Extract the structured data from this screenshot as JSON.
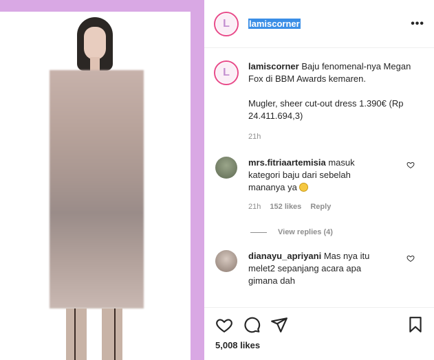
{
  "post": {
    "username": "lamiscorner",
    "avatar_letter": "L",
    "more_label": "•••"
  },
  "caption": {
    "username": "lamiscorner",
    "text": " Baju fenomenal-nya Megan Fox di BBM Awards kemaren.",
    "text2": "Mugler, sheer cut-out dress 1.390€ (Rp 24.411.694,3)",
    "time": "21h"
  },
  "comments": [
    {
      "username": "mrs.fitriaartemisia",
      "text": " masuk kategori baju dari sebelah mananya ya",
      "time": "21h",
      "likes": "152 likes",
      "reply": "Reply",
      "view_replies": "View replies (4)"
    },
    {
      "username": "dianayu_apriyani",
      "text": " Mas nya itu melet2 sepanjang acara apa gimana dah"
    }
  ],
  "footer": {
    "likes": "5,008 likes"
  },
  "colors": {
    "frame": "#d9a8e4",
    "highlight": "#3a8ee6"
  }
}
